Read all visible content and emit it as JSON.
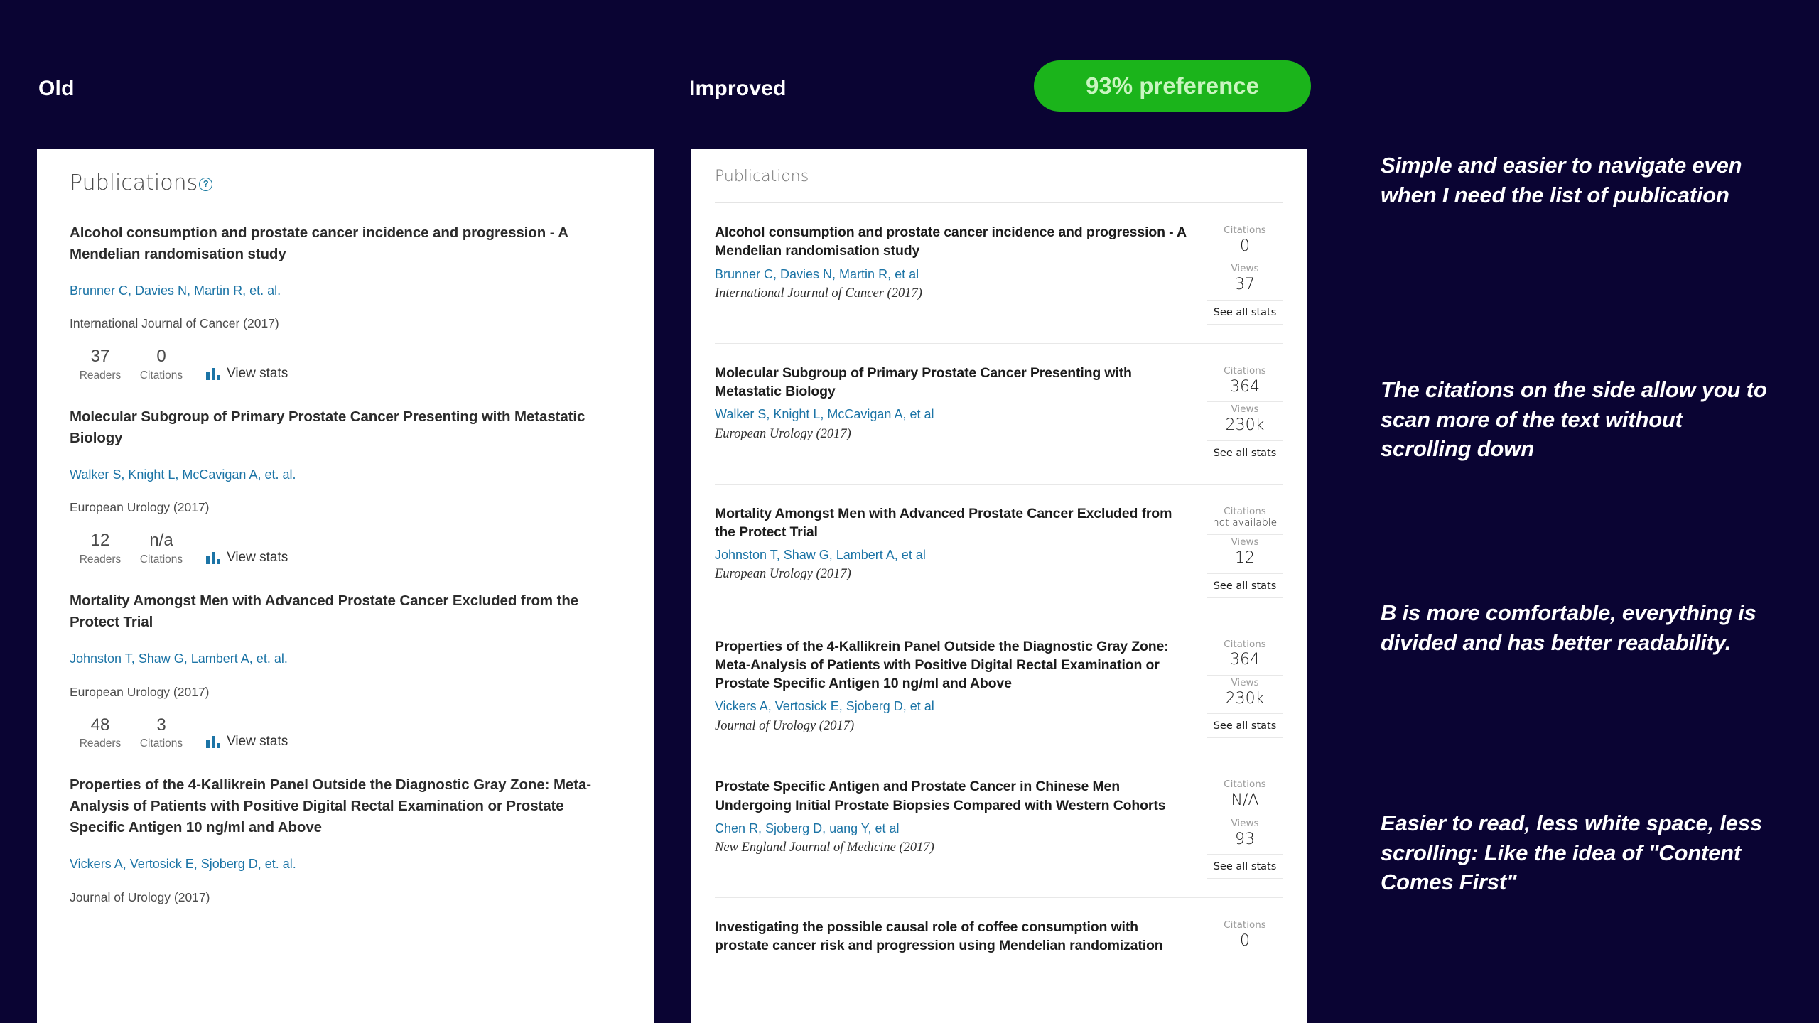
{
  "header": {
    "old_label": "Old",
    "improved_label": "Improved",
    "preference_badge": "93% preference",
    "badge_color": "#1bb41b",
    "badge_text_color": "#c9f5c0",
    "background_color": "#0a0433"
  },
  "old_panel": {
    "section_title": "Publications",
    "info_icon": "question-circle-icon",
    "stat_labels": {
      "readers": "Readers",
      "citations": "Citations"
    },
    "view_stats_label": "View stats",
    "view_stats_icon": "bar-chart-icon",
    "items": [
      {
        "title": "Alcohol consumption and prostate cancer incidence and progression - A Mendelian randomisation study",
        "authors": "Brunner C, Davies N, Martin R, et. al.",
        "journal": "International Journal of Cancer (2017)",
        "readers": "37",
        "citations": "0"
      },
      {
        "title": "Molecular Subgroup of Primary Prostate Cancer Presenting with Metastatic Biology",
        "authors": "Walker S, Knight L, McCavigan A, et. al.",
        "journal": "European Urology (2017)",
        "readers": "12",
        "citations": "n/a"
      },
      {
        "title": "Mortality Amongst Men with Advanced Prostate Cancer Excluded from the Protect Trial",
        "authors": "Johnston T, Shaw G, Lambert A, et. al.",
        "journal": "European Urology (2017)",
        "readers": "48",
        "citations": "3"
      },
      {
        "title": "Properties of the 4-Kallikrein Panel Outside the Diagnostic Gray Zone: Meta-Analysis of Patients with Positive Digital Rectal Examination or Prostate Specific Antigen 10 ng/ml and Above",
        "authors": "Vickers A, Vertosick E, Sjoberg D, et. al.",
        "journal": "Journal of Urology (2017)",
        "readers": "",
        "citations": ""
      }
    ]
  },
  "new_panel": {
    "section_title": "Publications",
    "rail_labels": {
      "citations": "Citations",
      "views": "Views"
    },
    "see_all_stats_label": "See all stats",
    "items": [
      {
        "title": "Alcohol consumption and prostate cancer incidence and progression - A Mendelian randomisation study",
        "authors": "Brunner C,  Davies N,  Martin R,  et al",
        "journal": "International Journal of Cancer (2017)",
        "citations": "0",
        "views": "37"
      },
      {
        "title": "Molecular Subgroup of Primary Prostate Cancer Presenting with Metastatic Biology",
        "authors": "Walker S,  Knight L,  McCavigan A,  et al",
        "journal": "European Urology (2017)",
        "citations": "364",
        "views": "230k"
      },
      {
        "title": "Mortality Amongst Men with Advanced Prostate Cancer Excluded from the Protect Trial",
        "authors": "Johnston T,  Shaw G,  Lambert A,  et al",
        "journal": "European Urology (2017)",
        "citations": "not available",
        "views": "12"
      },
      {
        "title": "Properties of the 4-Kallikrein Panel Outside the Diagnostic Gray Zone: Meta-Analysis of Patients with Positive Digital Rectal Examination or Prostate Specific Antigen 10 ng/ml and Above",
        "authors": "Vickers A,  Vertosick E,  Sjoberg D,  et al",
        "journal": "Journal of Urology (2017)",
        "citations": "364",
        "views": "230k"
      },
      {
        "title": "Prostate Specific Antigen and Prostate Cancer in Chinese Men Undergoing Initial Prostate Biopsies Compared with Western Cohorts",
        "authors": "Chen R,  Sjoberg D,  uang Y,  et al",
        "journal": "New England Journal of Medicine (2017)",
        "citations": "N/A",
        "views": "93"
      },
      {
        "title": "Investigating the possible causal role of coffee consumption with prostate cancer risk and progression using Mendelian randomization",
        "authors": "",
        "journal": "",
        "citations": "0",
        "views": ""
      }
    ]
  },
  "quotes": [
    "Simple and easier to navigate even when I need the list of publication",
    "The citations on the side allow you to scan more of the text without scrolling down",
    "B is more comfortable, everything is divided and has better readability.",
    "Easier to read, less white space, less scrolling: Like the idea of \"Content Comes First\""
  ]
}
